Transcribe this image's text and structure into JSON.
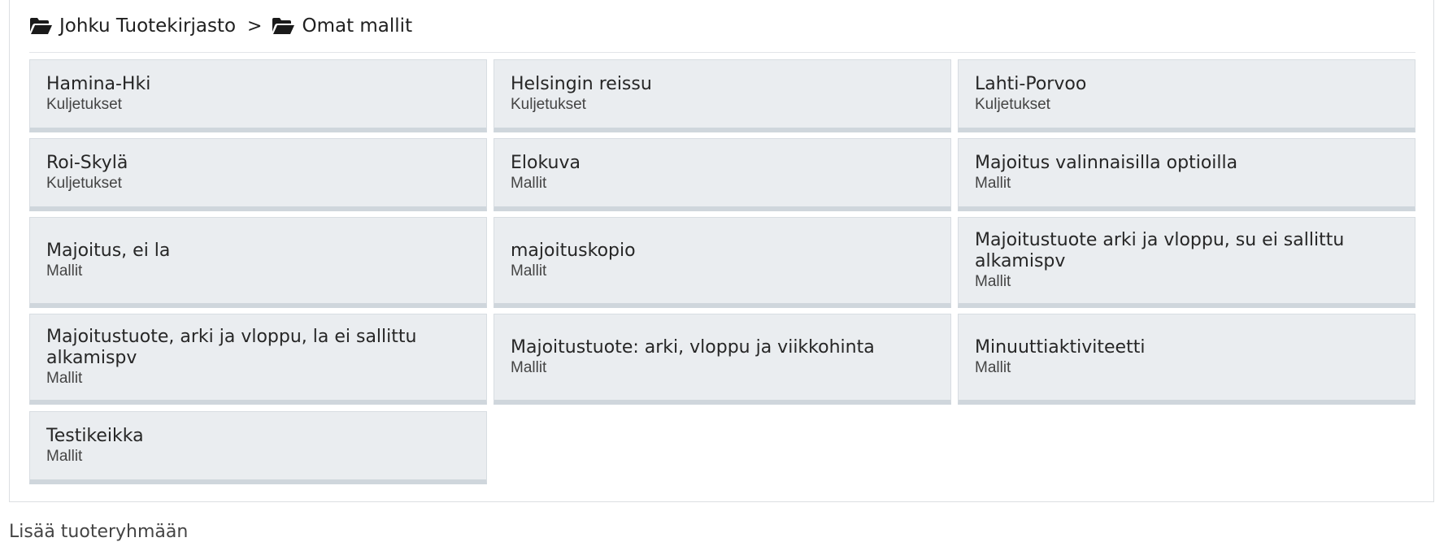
{
  "breadcrumb": {
    "items": [
      {
        "label": "Johku Tuotekirjasto",
        "icon": "folder-open-icon"
      },
      {
        "label": "Omat mallit",
        "icon": "folder-open-icon"
      }
    ],
    "separator": ">"
  },
  "products": [
    {
      "title": "Hamina-Hki",
      "category": "Kuljetukset"
    },
    {
      "title": "Helsingin reissu",
      "category": "Kuljetukset"
    },
    {
      "title": "Lahti-Porvoo",
      "category": "Kuljetukset"
    },
    {
      "title": "Roi-Skylä",
      "category": "Kuljetukset"
    },
    {
      "title": "Elokuva",
      "category": "Mallit"
    },
    {
      "title": "Majoitus valinnaisilla optioilla",
      "category": "Mallit"
    },
    {
      "title": "Majoitus, ei la",
      "category": "Mallit"
    },
    {
      "title": "majoituskopio",
      "category": "Mallit"
    },
    {
      "title": "Majoitustuote arki ja vloppu, su ei sallittu alkamispv",
      "category": "Mallit"
    },
    {
      "title": "Majoitustuote, arki ja vloppu, la ei sallittu alkamispv",
      "category": "Mallit"
    },
    {
      "title": "Majoitustuote: arki, vloppu ja viikkohinta",
      "category": "Mallit"
    },
    {
      "title": "Minuuttiaktiviteetti",
      "category": "Mallit"
    },
    {
      "title": "Testikeikka",
      "category": "Mallit"
    }
  ],
  "footer": {
    "text": "Lisää tuoteryhmään"
  }
}
